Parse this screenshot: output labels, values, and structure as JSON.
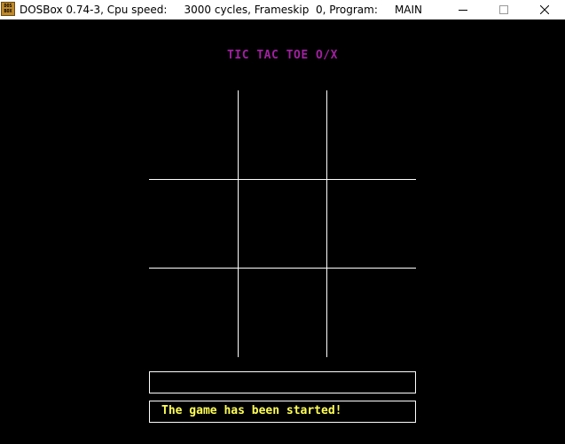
{
  "window": {
    "title": "DOSBox 0.74-3, Cpu speed:     3000 cycles, Frameskip  0, Program:     MAIN",
    "icon_name": "dosbox-icon",
    "icon_text_line1": "DOS",
    "icon_text_line2": "BOX",
    "controls": [
      "minimize",
      "maximize",
      "close"
    ]
  },
  "game": {
    "title": "TIC TAC TOE O/X",
    "board": {
      "rows": 3,
      "cols": 3,
      "cells": [
        "",
        "",
        "",
        "",
        "",
        "",
        "",
        "",
        ""
      ]
    },
    "input_value": "",
    "status_message": "The game has been started!"
  },
  "colors": {
    "background": "#000000",
    "title": "#a020a0",
    "status_text": "#ffff55",
    "gridlines": "#ffffff"
  }
}
